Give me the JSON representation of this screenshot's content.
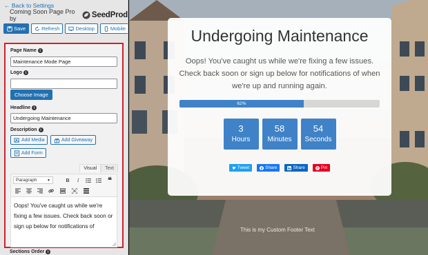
{
  "sidebar": {
    "back_link": "← Back to Settings",
    "brand_title": "Coming Soon Page Pro by",
    "brand_logo_text": "SeedProd",
    "toolbar": {
      "save": "Save",
      "refresh": "Refresh",
      "desktop": "Desktop",
      "mobile": "Mobile"
    },
    "fields": {
      "page_name_label": "Page Name",
      "page_name_value": "Maintenance Mode Page",
      "logo_label": "Logo",
      "logo_value": "",
      "choose_image": "Choose Image",
      "headline_label": "Headline",
      "headline_value": "Undergoing Maintenance",
      "description_label": "Description",
      "add_media": "Add Media",
      "add_giveaway": "Add Giveaway",
      "add_form": "Add Form",
      "tab_visual": "Visual",
      "tab_text": "Text",
      "paragraph_select": "Paragraph",
      "editor_content": "Oops! You've caught us while we're fixing a few issues. Check back soon or sign up below for notifications of",
      "sections_order_label": "Sections Order"
    }
  },
  "preview": {
    "headline": "Undergoing Maintenance",
    "description": "Oops! You've caught us while we're fixing a few issues. Check back soon or sign up below for notifications of when we're up and running again.",
    "progress_percent": 62,
    "progress_text": "62%",
    "countdown": [
      {
        "value": "3",
        "unit": "Hours"
      },
      {
        "value": "58",
        "unit": "Minutes"
      },
      {
        "value": "54",
        "unit": "Seconds"
      }
    ],
    "share": {
      "tweet": "Tweet",
      "facebook": "Share",
      "linkedin": "Share",
      "pinterest": "Pin"
    },
    "footer_text": "This is my Custom Footer Text"
  },
  "colors": {
    "accent": "#2271b1",
    "progress": "#3f82c7",
    "highlight_border": "#d21e2b",
    "twitter": "#1da1f2",
    "facebook": "#1877f2",
    "linkedin": "#0a66c2",
    "pinterest": "#e60023"
  }
}
